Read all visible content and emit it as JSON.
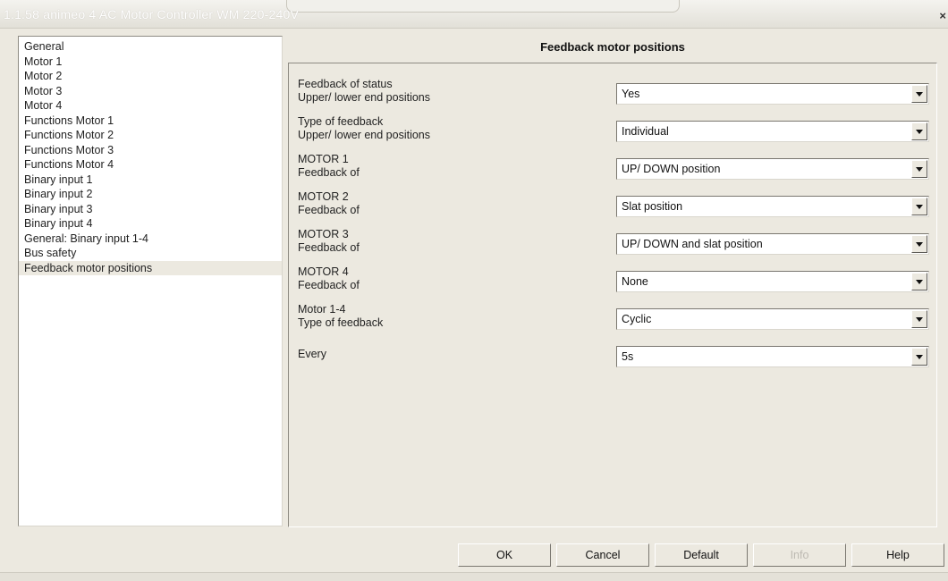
{
  "window": {
    "title": "1.1.58 animeo 4 AC Motor Controller WM 220-240V",
    "close_glyph": "×"
  },
  "sidebar": {
    "items": [
      {
        "label": "General"
      },
      {
        "label": "Motor 1"
      },
      {
        "label": "Motor 2"
      },
      {
        "label": "Motor 3"
      },
      {
        "label": "Motor 4"
      },
      {
        "label": "Functions Motor 1"
      },
      {
        "label": "Functions Motor 2"
      },
      {
        "label": "Functions Motor 3"
      },
      {
        "label": "Functions Motor 4"
      },
      {
        "label": "Binary input 1"
      },
      {
        "label": "Binary input 2"
      },
      {
        "label": "Binary input 3"
      },
      {
        "label": "Binary input 4"
      },
      {
        "label": "General: Binary input 1-4"
      },
      {
        "label": "Bus safety"
      },
      {
        "label": "Feedback motor positions"
      }
    ],
    "selected": "Feedback motor positions"
  },
  "panel": {
    "title": "Feedback motor positions",
    "params": [
      {
        "label1": "Feedback of status",
        "label2": "Upper/ lower end positions",
        "value": "Yes"
      },
      {
        "label1": "Type of feedback",
        "label2": "Upper/ lower end positions",
        "value": "Individual"
      },
      {
        "label1": "MOTOR 1",
        "label2": "Feedback of",
        "value": "UP/ DOWN position"
      },
      {
        "label1": "MOTOR 2",
        "label2": "Feedback of",
        "value": "Slat position"
      },
      {
        "label1": "MOTOR 3",
        "label2": "Feedback of",
        "value": "UP/ DOWN and slat position"
      },
      {
        "label1": "MOTOR 4",
        "label2": "Feedback of",
        "value": "None"
      },
      {
        "label1": "Motor 1-4",
        "label2": "Type of feedback",
        "value": "Cyclic"
      },
      {
        "label1": "Every",
        "label2": "",
        "value": "5s"
      }
    ]
  },
  "buttons": {
    "ok": "OK",
    "cancel": "Cancel",
    "default": "Default",
    "info": "Info",
    "help": "Help"
  }
}
